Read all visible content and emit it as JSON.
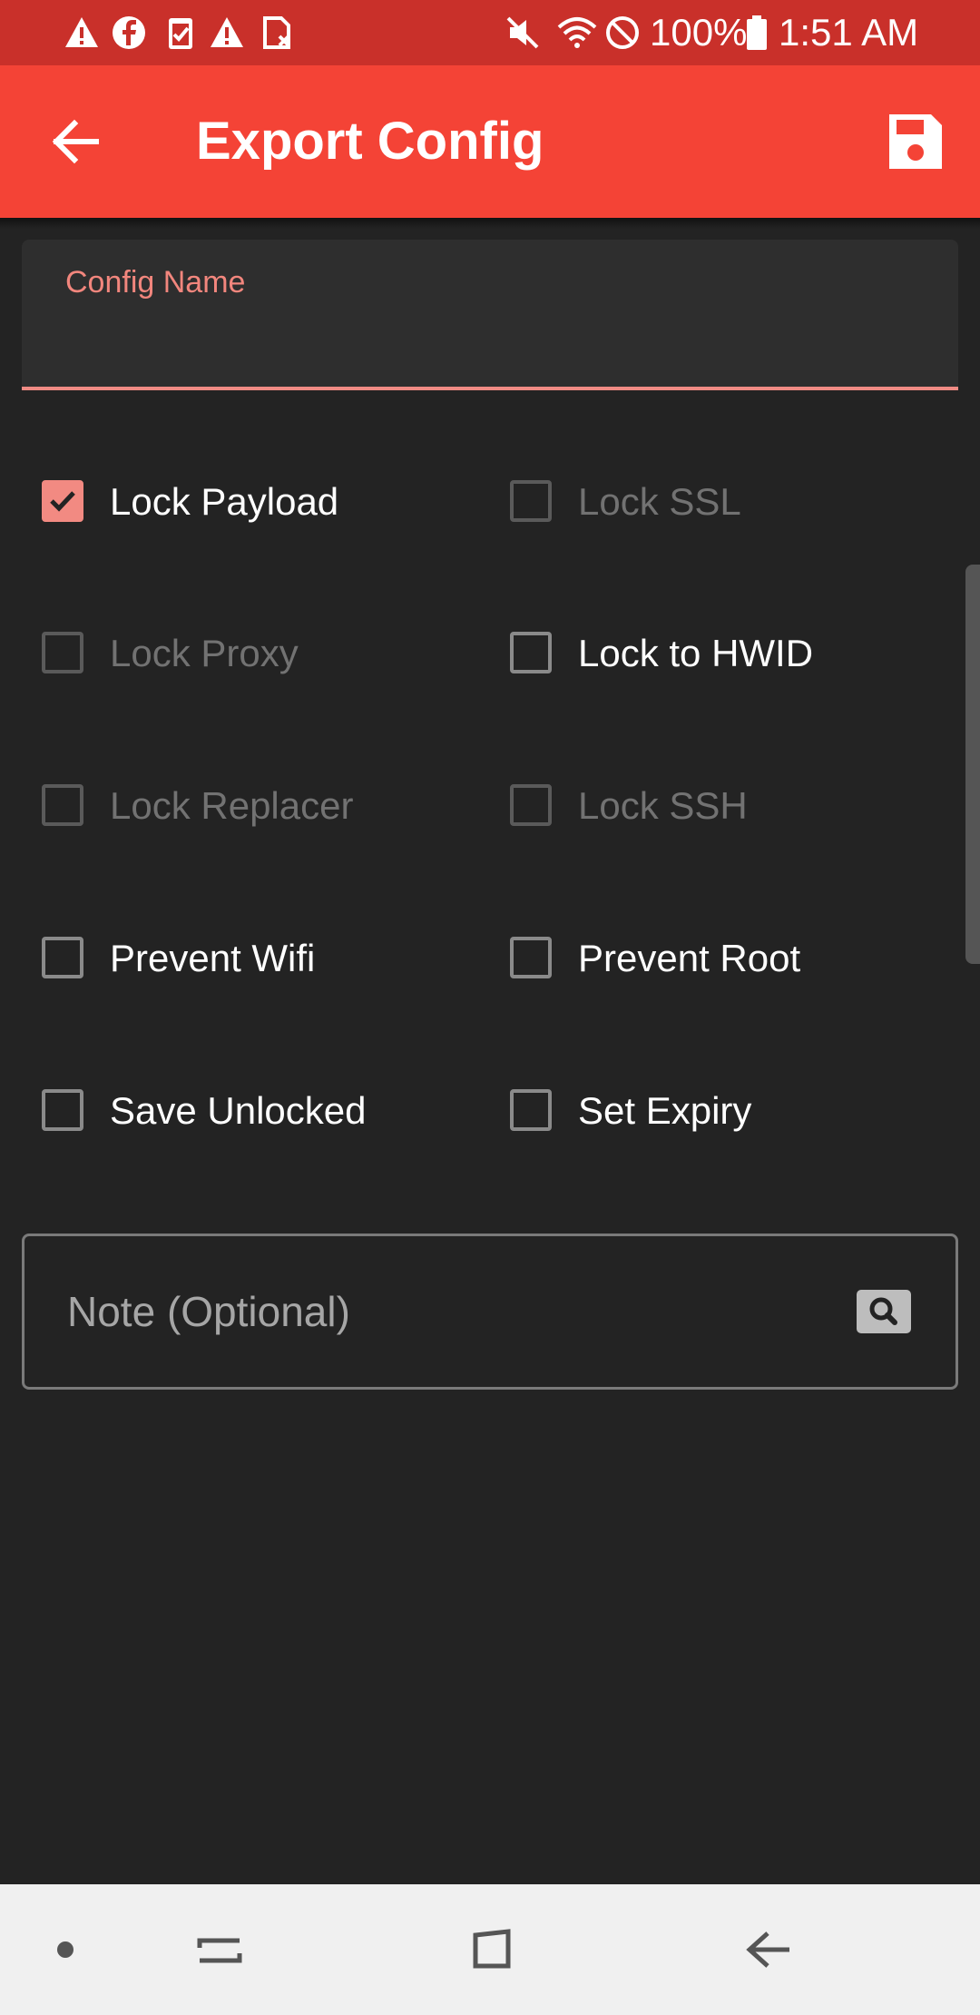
{
  "status_bar": {
    "battery": "100%",
    "time": "1:51 AM",
    "left_icons": [
      "warning-icon",
      "facebook-icon",
      "clipboard-check-icon",
      "warning-icon",
      "sim-card-icon"
    ],
    "right_icons": [
      "mute-icon",
      "wifi-icon",
      "do-not-disturb-icon",
      "battery-icon"
    ]
  },
  "app_bar": {
    "title": "Export Config",
    "back_icon": "arrow-back-icon",
    "save_icon": "save-icon"
  },
  "config_name": {
    "label": "Config Name",
    "value": ""
  },
  "options": [
    {
      "label": "Lock Payload",
      "checked": true,
      "enabled": true
    },
    {
      "label": "Lock SSL",
      "checked": false,
      "enabled": false
    },
    {
      "label": "Lock Proxy",
      "checked": false,
      "enabled": false
    },
    {
      "label": "Lock to HWID",
      "checked": false,
      "enabled": true
    },
    {
      "label": "Lock Replacer",
      "checked": false,
      "enabled": false
    },
    {
      "label": "Lock SSH",
      "checked": false,
      "enabled": false
    },
    {
      "label": "Prevent Wifi",
      "checked": false,
      "enabled": true
    },
    {
      "label": "Prevent Root",
      "checked": false,
      "enabled": true
    },
    {
      "label": "Save Unlocked",
      "checked": false,
      "enabled": true
    },
    {
      "label": "Set Expiry",
      "checked": false,
      "enabled": true
    }
  ],
  "note": {
    "placeholder": "Note (Optional)",
    "value": "",
    "icon": "search-icon"
  },
  "nav_bar": [
    "dot-icon",
    "recents-icon",
    "home-icon",
    "back-icon"
  ],
  "colors": {
    "accent": "#f44336",
    "status_bar": "#c9302a",
    "background": "#232323",
    "checkbox_checked": "#f28a82"
  }
}
